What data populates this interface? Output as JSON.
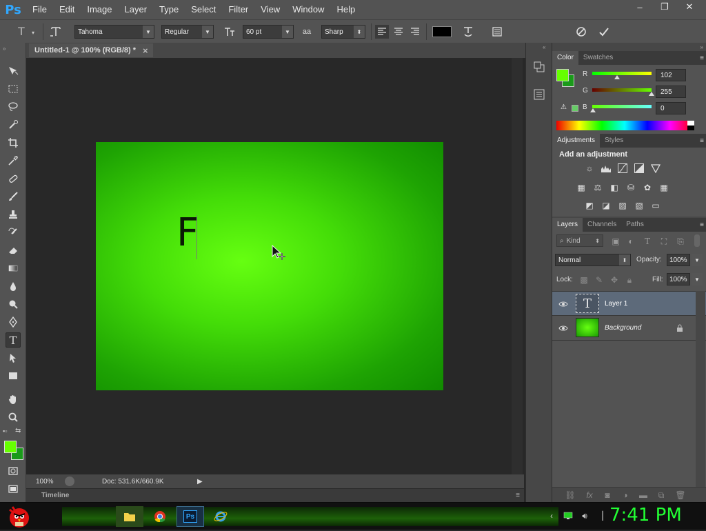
{
  "app": {
    "logo": "Ps"
  },
  "menu": [
    "File",
    "Edit",
    "Image",
    "Layer",
    "Type",
    "Select",
    "Filter",
    "View",
    "Window",
    "Help"
  ],
  "window_controls": [
    "–",
    "❐",
    "✕"
  ],
  "options": {
    "tool_icon": "T",
    "font_family": "Tahoma",
    "font_style": "Regular",
    "font_size": "60 pt",
    "aa_icon": "aa",
    "antialias": "Sharp",
    "color_swatch": "#000000"
  },
  "document": {
    "tab_title": "Untitled-1 @ 100% (RGB/8) *",
    "tab_close": "×",
    "canvas_text": "F",
    "zoom": "100%",
    "doc_info": "Doc: 531.6K/660.9K",
    "timeline_label": "Timeline"
  },
  "color_panel": {
    "tabs": [
      "Color",
      "Swatches"
    ],
    "r_label": "R",
    "r_value": "102",
    "g_label": "G",
    "g_value": "255",
    "b_label": "B",
    "b_value": "0",
    "foreground": "#66ff00",
    "background": "#1a9a1a"
  },
  "adjustments_panel": {
    "tabs": [
      "Adjustments",
      "Styles"
    ],
    "heading": "Add an adjustment"
  },
  "layers_panel": {
    "tabs": [
      "Layers",
      "Channels",
      "Paths"
    ],
    "kind_label": "Kind",
    "blend_mode": "Normal",
    "opacity_label": "Opacity:",
    "opacity_value": "100%",
    "lock_label": "Lock:",
    "fill_label": "Fill:",
    "fill_value": "100%",
    "layers": [
      {
        "name": "Layer 1",
        "type": "text",
        "selected": true
      },
      {
        "name": "Background",
        "type": "fill",
        "selected": false
      }
    ]
  },
  "taskbar": {
    "clock": "7:41 PM",
    "apps": [
      "folder-icon",
      "chrome-icon",
      "photoshop-icon",
      "ie-icon"
    ],
    "ps_label": "Ps"
  },
  "colors": {
    "accent_green": "#22ff33",
    "canvas_center": "#66ff11",
    "canvas_edge": "#108a00"
  }
}
